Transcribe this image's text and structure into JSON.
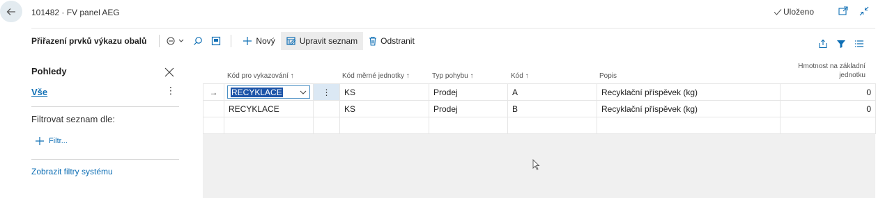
{
  "header": {
    "title": "101482 · FV panel AEG",
    "saved_label": "Uloženo"
  },
  "action_bar": {
    "title": "Přiřazení prvků výkazu obalů",
    "new_label": "Nový",
    "edit_list_label": "Upravit seznam",
    "delete_label": "Odstranit"
  },
  "sidebar": {
    "title": "Pohledy",
    "all_label": "Vše",
    "filter_by_label": "Filtrovat seznam dle:",
    "add_filter_label": "Filtr...",
    "show_system_filters_label": "Zobrazit filtry systému"
  },
  "table": {
    "columns": {
      "reporting_code": "Kód pro vykazování ↑",
      "uom_code": "Kód měrné jednotky ↑",
      "movement_type": "Typ pohybu ↑",
      "code": "Kód ↑",
      "description": "Popis",
      "weight": "Hmotnost na základní",
      "weight_2": "jednotku"
    },
    "rows": [
      {
        "reporting_code": "RECYKLACE",
        "uom_code": "KS",
        "movement_type": "Prodej",
        "code": "A",
        "description": "Recyklační příspěvek (kg)",
        "weight": "0"
      },
      {
        "reporting_code": "RECYKLACE",
        "uom_code": "KS",
        "movement_type": "Prodej",
        "code": "B",
        "description": "Recyklační příspěvek (kg)",
        "weight": "0"
      }
    ]
  },
  "colors": {
    "accent": "#0f6fb5",
    "selection": "#1c54a8",
    "grid_background": "#f0f0f0"
  }
}
